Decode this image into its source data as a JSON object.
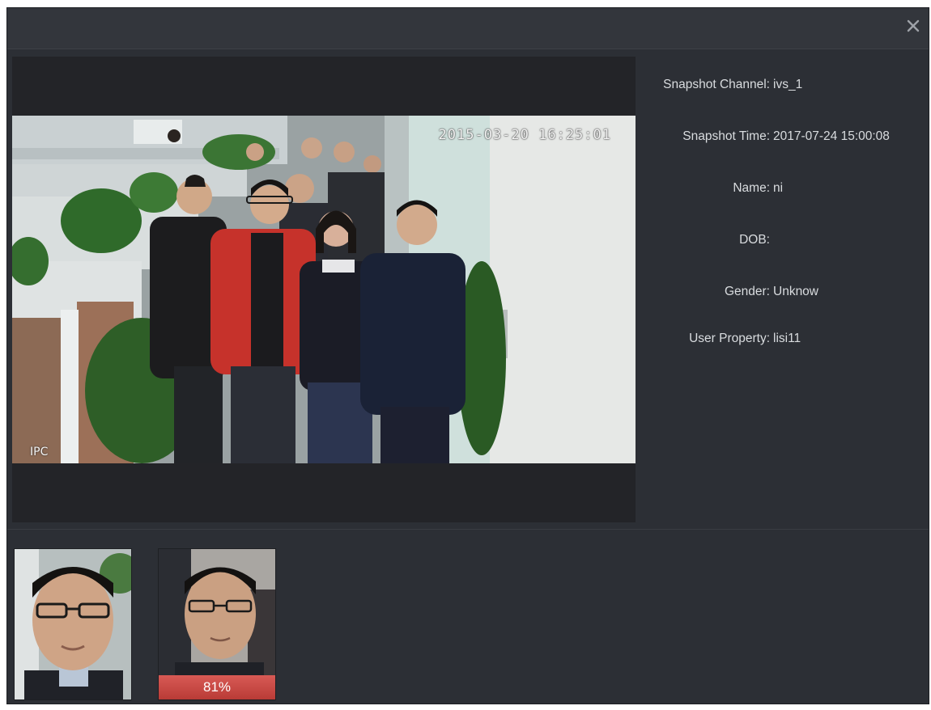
{
  "dialog": {
    "close_icon": "close-icon"
  },
  "snapshot": {
    "osd_timestamp": "2015-03-20 16:25:01",
    "osd_camera_label": "IPC"
  },
  "info": {
    "channel": {
      "label": "Snapshot Channel:",
      "value": "ivs_1"
    },
    "time": {
      "label": "Snapshot Time:",
      "value": "2017-07-24 15:00:08"
    },
    "name": {
      "label": "Name:",
      "value": "ni"
    },
    "dob": {
      "label": "DOB:",
      "value": ""
    },
    "gender": {
      "label": "Gender:",
      "value": "Unknow"
    },
    "user_property": {
      "label": "User Property:",
      "value": "lisi11"
    }
  },
  "thumbnails": {
    "snapshot_face": {
      "icon": "face-snapshot-image"
    },
    "matched_face": {
      "icon": "face-match-image",
      "similarity": "81%"
    }
  },
  "colors": {
    "dialog_bg": "#2c2f35",
    "video_bg": "#232428",
    "match_bar": "#c8453f",
    "text": "#d9dcdf"
  }
}
